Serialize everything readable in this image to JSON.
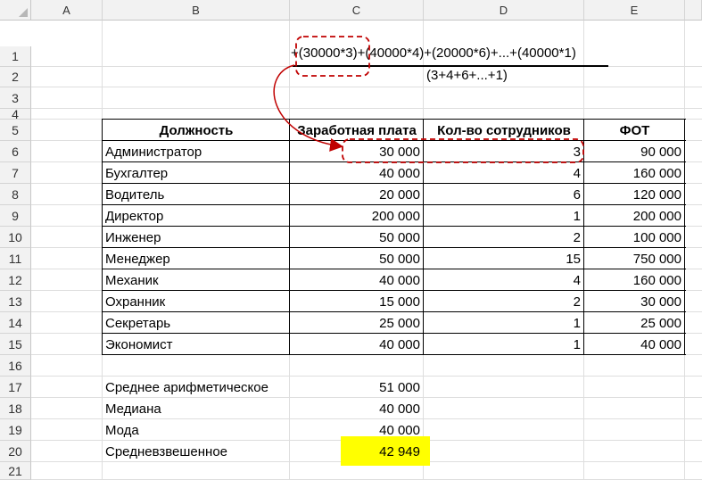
{
  "columns": [
    "A",
    "B",
    "C",
    "D",
    "E"
  ],
  "rows": [
    "1",
    "2",
    "3",
    "4",
    "5",
    "6",
    "7",
    "8",
    "9",
    "10",
    "11",
    "12",
    "13",
    "14",
    "15",
    "16",
    "17",
    "18",
    "19",
    "20",
    "21"
  ],
  "formula": {
    "numerator": "+(30000*3)+(40000*4)+(20000*6)+...+(40000*1)",
    "denominator": "(3+4+6+...+1)"
  },
  "table": {
    "headers": [
      "Должность",
      "Заработная плата",
      "Кол-во сотрудников",
      "ФОТ"
    ],
    "rows": [
      [
        "Администратор",
        "30 000",
        "3",
        "90 000"
      ],
      [
        "Бухгалтер",
        "40 000",
        "4",
        "160 000"
      ],
      [
        "Водитель",
        "20 000",
        "6",
        "120 000"
      ],
      [
        "Директор",
        "200 000",
        "1",
        "200 000"
      ],
      [
        "Инженер",
        "50 000",
        "2",
        "100 000"
      ],
      [
        "Менеджер",
        "50 000",
        "15",
        "750 000"
      ],
      [
        "Механик",
        "40 000",
        "4",
        "160 000"
      ],
      [
        "Охранник",
        "15 000",
        "2",
        "30 000"
      ],
      [
        "Секретарь",
        "25 000",
        "1",
        "25 000"
      ],
      [
        "Экономист",
        "40 000",
        "1",
        "40 000"
      ]
    ]
  },
  "stats": [
    {
      "label": "Среднее арифметическое",
      "value": "51 000"
    },
    {
      "label": "Медиана",
      "value": "40 000"
    },
    {
      "label": "Мода",
      "value": "40 000"
    },
    {
      "label": "Средневзвешенное",
      "value": "42 949"
    }
  ],
  "colors": {
    "highlight": "#ffff00",
    "annotation": "#c00000",
    "header_bg": "#f2f2f2",
    "gridline": "#dedede"
  }
}
